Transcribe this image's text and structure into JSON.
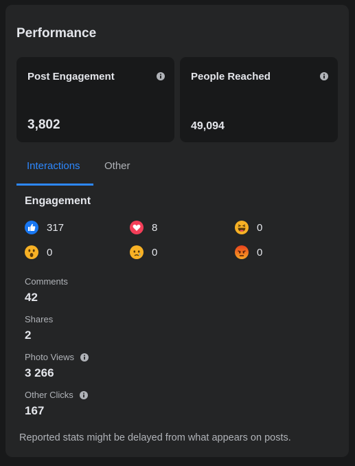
{
  "title": "Performance",
  "cards": [
    {
      "label": "Post Engagement",
      "value": "3,802"
    },
    {
      "label": "People Reached",
      "value": "49,094"
    }
  ],
  "tabs": [
    {
      "label": "Interactions",
      "active": true
    },
    {
      "label": "Other",
      "active": false
    }
  ],
  "engagement": {
    "title": "Engagement",
    "reactions": [
      {
        "icon": "like-icon",
        "count": "317"
      },
      {
        "icon": "love-icon",
        "count": "8"
      },
      {
        "icon": "haha-icon",
        "count": "0"
      },
      {
        "icon": "wow-icon",
        "count": "0"
      },
      {
        "icon": "sad-icon",
        "count": "0"
      },
      {
        "icon": "angry-icon",
        "count": "0"
      }
    ]
  },
  "stats": [
    {
      "label": "Comments",
      "value": "42"
    },
    {
      "label": "Shares",
      "value": "2"
    },
    {
      "label": "Photo Views",
      "value": "3 266"
    },
    {
      "label": "Other Clicks",
      "value": "167"
    }
  ],
  "footer": "Reported stats might be delayed from what appears on posts.",
  "colors": {
    "background": "#242526",
    "card": "#18191a",
    "accent": "#2d88ff",
    "text": "#e4e6eb",
    "muted": "#b0b3b8"
  }
}
